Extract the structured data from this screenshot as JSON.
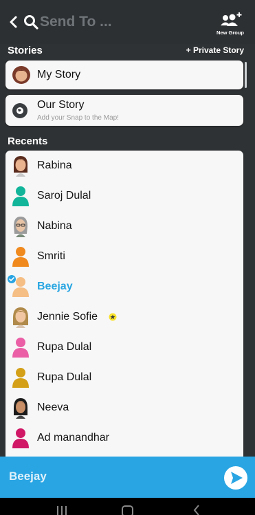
{
  "header": {
    "search_placeholder": "Send To ...",
    "new_group_label": "New Group"
  },
  "stories": {
    "title": "Stories",
    "private_story_label": "+ Private Story",
    "my_story": "My Story",
    "our_story": "Our Story",
    "our_story_sub": "Add your Snap to the Map!"
  },
  "recents": {
    "title": "Recents",
    "items": [
      {
        "name": "Rabina",
        "selected": false
      },
      {
        "name": "Saroj Dulal",
        "selected": false
      },
      {
        "name": "Nabina",
        "selected": false
      },
      {
        "name": "Smriti",
        "selected": false
      },
      {
        "name": "Beejay",
        "selected": true
      },
      {
        "name": "Jennie Sofie",
        "selected": false
      },
      {
        "name": "Rupa Dulal",
        "selected": false
      },
      {
        "name": "Rupa Dulal",
        "selected": false
      },
      {
        "name": "Neeva",
        "selected": false
      },
      {
        "name": "Ad manandhar",
        "selected": false
      }
    ]
  },
  "send_bar": {
    "recipients": "Beejay"
  },
  "colors": {
    "accent": "#2aa5e3",
    "background": "#2f3234",
    "card": "#f7f7f7"
  }
}
